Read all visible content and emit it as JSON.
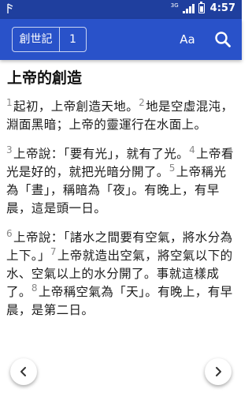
{
  "status_bar": {
    "network_label": "3G",
    "time": "4:57"
  },
  "app_bar": {
    "book": "創世記",
    "chapter": "1",
    "font_button_label": "Aa",
    "search_icon": "search-icon"
  },
  "chapter": {
    "heading": "上帝的創造",
    "paragraphs": [
      [
        {
          "num": "1",
          "text": "起初，上帝創造天地。"
        },
        {
          "num": "2",
          "text": "地是空虛混沌，淵面黑暗；上帝的靈運行在水面上。"
        }
      ],
      [
        {
          "num": "3",
          "text": "上帝說：「要有光」，就有了光。"
        },
        {
          "num": "4",
          "text": "上帝看光是好的，就把光暗分開了。"
        },
        {
          "num": "5",
          "text": "上帝稱光為「晝」，稱暗為「夜」。有晚上，有早晨，這是頭一日。"
        }
      ],
      [
        {
          "num": "6",
          "text": "上帝說：「諸水之間要有空氣，將水分為上下。」"
        },
        {
          "num": "7",
          "text": "上帝就造出空氣，將空氣以下的水、空氣以上的水分開了。事就這樣成了。"
        },
        {
          "num": "8",
          "text": "上帝稱空氣為「天」。有晚上，有早晨，是第二日。"
        }
      ]
    ]
  },
  "navigation": {
    "prev_icon": "chevron-left-icon",
    "next_icon": "chevron-right-icon"
  },
  "colors": {
    "status_bar": "#1f3f9e",
    "app_bar": "#2952c9",
    "verse_number": "#888888"
  }
}
